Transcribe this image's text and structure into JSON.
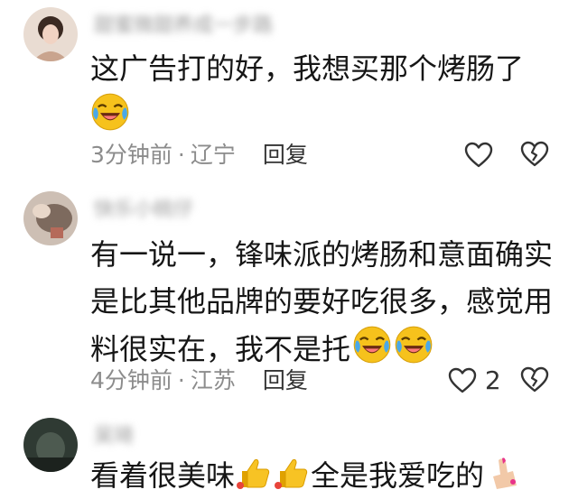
{
  "comments": [
    {
      "username": "甜蜜微甜养成一步路",
      "text_lines": [
        "这广告打的好，我想买那个烤肠了"
      ],
      "time": "3分钟前",
      "location": "辽宁",
      "reply_label": "回复",
      "like_count": "",
      "emoji_line2": "laughing-crying-emoji"
    },
    {
      "username": "快乐小桃仔",
      "text_lines": [
        "有一说一，锋味派的烤肠和意面确实",
        "是比其他品牌的要好吃很多，感觉用",
        "料很实在，我不是托"
      ],
      "time": "4分钟前",
      "location": "江苏",
      "reply_label": "回复",
      "like_count": "2",
      "emoji_tail": [
        "laughing-crying-emoji",
        "laughing-crying-emoji"
      ]
    },
    {
      "username": "吴琦",
      "text_parts": [
        "看着很美味",
        "全是我爱吃的"
      ],
      "emoji_inline": [
        "thumbs-up-emoji",
        "thumbs-up-emoji",
        "nail-polish-emoji"
      ]
    }
  ],
  "colors": {
    "text": "#161616",
    "meta": "#8c8c8c",
    "emoji_yellow": "#f6c21c",
    "emoji_blue": "#4aa8e8"
  }
}
